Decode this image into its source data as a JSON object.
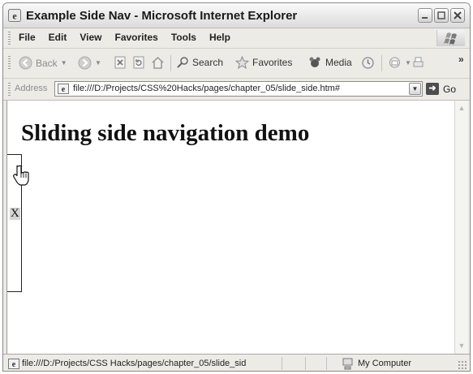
{
  "window": {
    "title": "Example Side Nav - Microsoft Internet Explorer"
  },
  "menu": {
    "items": [
      "File",
      "Edit",
      "View",
      "Favorites",
      "Tools",
      "Help"
    ]
  },
  "toolbar": {
    "back_label": "Back",
    "search_label": "Search",
    "favorites_label": "Favorites",
    "media_label": "Media",
    "chevron": "»"
  },
  "address": {
    "label": "Address",
    "url": "file:///D:/Projects/CSS%20Hacks/pages/chapter_05/slide_side.htm#",
    "go_label": "Go"
  },
  "page": {
    "heading": "Sliding side navigation demo",
    "tab_glyph": "X"
  },
  "status": {
    "text": "file:///D:/Projects/CSS Hacks/pages/chapter_05/slide_sid",
    "zone": "My Computer"
  }
}
